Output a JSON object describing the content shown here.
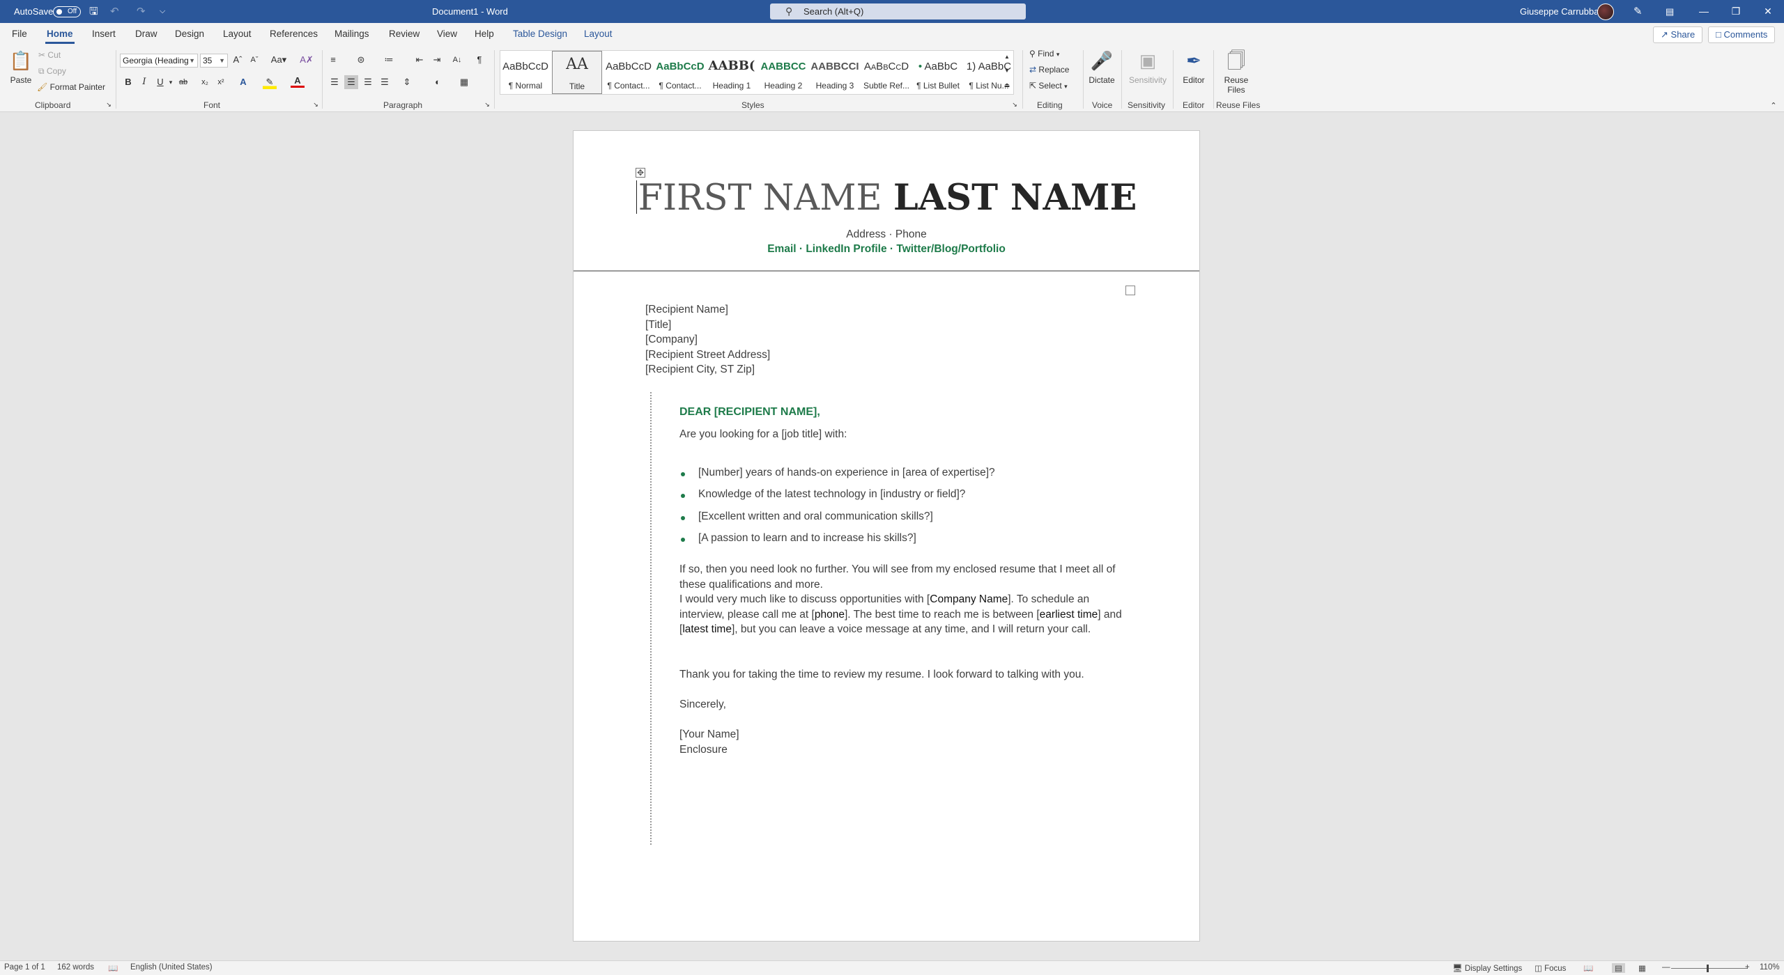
{
  "titlebar": {
    "autosave_label": "AutoSave",
    "autosave_state": "Off",
    "doc_title": "Document1 - Word",
    "search_placeholder": "Search (Alt+Q)",
    "user_name": "Giuseppe Carrubba",
    "accent_color": "#2b579a"
  },
  "tabs": [
    "File",
    "Home",
    "Insert",
    "Draw",
    "Design",
    "Layout",
    "References",
    "Mailings",
    "Review",
    "View",
    "Help",
    "Table Design",
    "Layout"
  ],
  "active_tab": "Home",
  "top_right": {
    "share": "Share",
    "comments": "Comments"
  },
  "clipboard": {
    "paste": "Paste",
    "cut": "Cut",
    "copy": "Copy",
    "format_painter": "Format Painter",
    "label": "Clipboard"
  },
  "font": {
    "name": "Georgia (Heading",
    "size": "35",
    "label": "Font"
  },
  "paragraph": {
    "label": "Paragraph"
  },
  "styles": {
    "label": "Styles",
    "items": [
      {
        "preview": "AaBbCcD",
        "name": "¶ Normal"
      },
      {
        "preview": "AA",
        "name": "Title"
      },
      {
        "preview": "AaBbCcD",
        "name": "¶ Contact..."
      },
      {
        "preview": "AaBbCcD",
        "name": "¶ Contact..."
      },
      {
        "preview": "AABB(",
        "name": "Heading 1"
      },
      {
        "preview": "AABBCC",
        "name": "Heading 2"
      },
      {
        "preview": "AABBCCI",
        "name": "Heading 3"
      },
      {
        "preview": "AaBbCcD",
        "name": "Subtle Ref..."
      },
      {
        "preview": "AaBbC",
        "name": "¶ List Bullet"
      },
      {
        "preview": "1) AaBbC",
        "name": "¶ List Nu..."
      }
    ]
  },
  "editing": {
    "find": "Find",
    "replace": "Replace",
    "select": "Select",
    "label": "Editing"
  },
  "voice": {
    "dictate": "Dictate",
    "label": "Voice"
  },
  "sensitivity": {
    "button": "Sensitivity",
    "label": "Sensitivity"
  },
  "editor": {
    "button": "Editor",
    "label": "Editor"
  },
  "reuse": {
    "button_line1": "Reuse",
    "button_line2": "Files",
    "label": "Reuse Files"
  },
  "document": {
    "first_name": "FIRST NAME",
    "last_name": "LAST NAME",
    "address_line": "Address · Phone",
    "links_line": "Email · LinkedIn Profile · Twitter/Blog/Portfolio",
    "recipient": [
      "[Recipient Name]",
      "[Title]",
      "[Company]",
      "[Recipient Street Address]",
      "[Recipient City, ST Zip]"
    ],
    "salutation": "DEAR [RECIPIENT NAME],",
    "intro": "Are you looking for a [job title] with:",
    "bullets": [
      "[Number] years of hands-on experience in [area of expertise]?",
      "Knowledge of the latest technology in [industry or field]?",
      "[Excellent written and oral communication skills?]",
      "[A passion to learn and to increase his skills?]"
    ],
    "para1": "If so, then you need look no further. You will see from my enclosed resume that I meet all of these qualifications and more.",
    "para2": {
      "t1": "I would very much like to discuss opportunities with [",
      "company": "Company Name",
      "t2": "]. To schedule an interview, please call me at [",
      "phone": "phone",
      "t3": "]. The best time to reach me is between [",
      "earliest": "earliest time",
      "t4": "] and [",
      "latest": "latest time",
      "t5": "], but you can leave a voice message at any time, and I will return your call."
    },
    "para3": "Thank you for taking the time to review my resume. I look forward to talking with you.",
    "closing": "Sincerely,",
    "your_name": "[Your Name]",
    "enclosure": "Enclosure",
    "accent_color": "#1e7b4a"
  },
  "statusbar": {
    "page": "Page 1 of 1",
    "words": "162 words",
    "language": "English (United States)",
    "display_settings": "Display Settings",
    "focus": "Focus",
    "zoom": "110%"
  }
}
